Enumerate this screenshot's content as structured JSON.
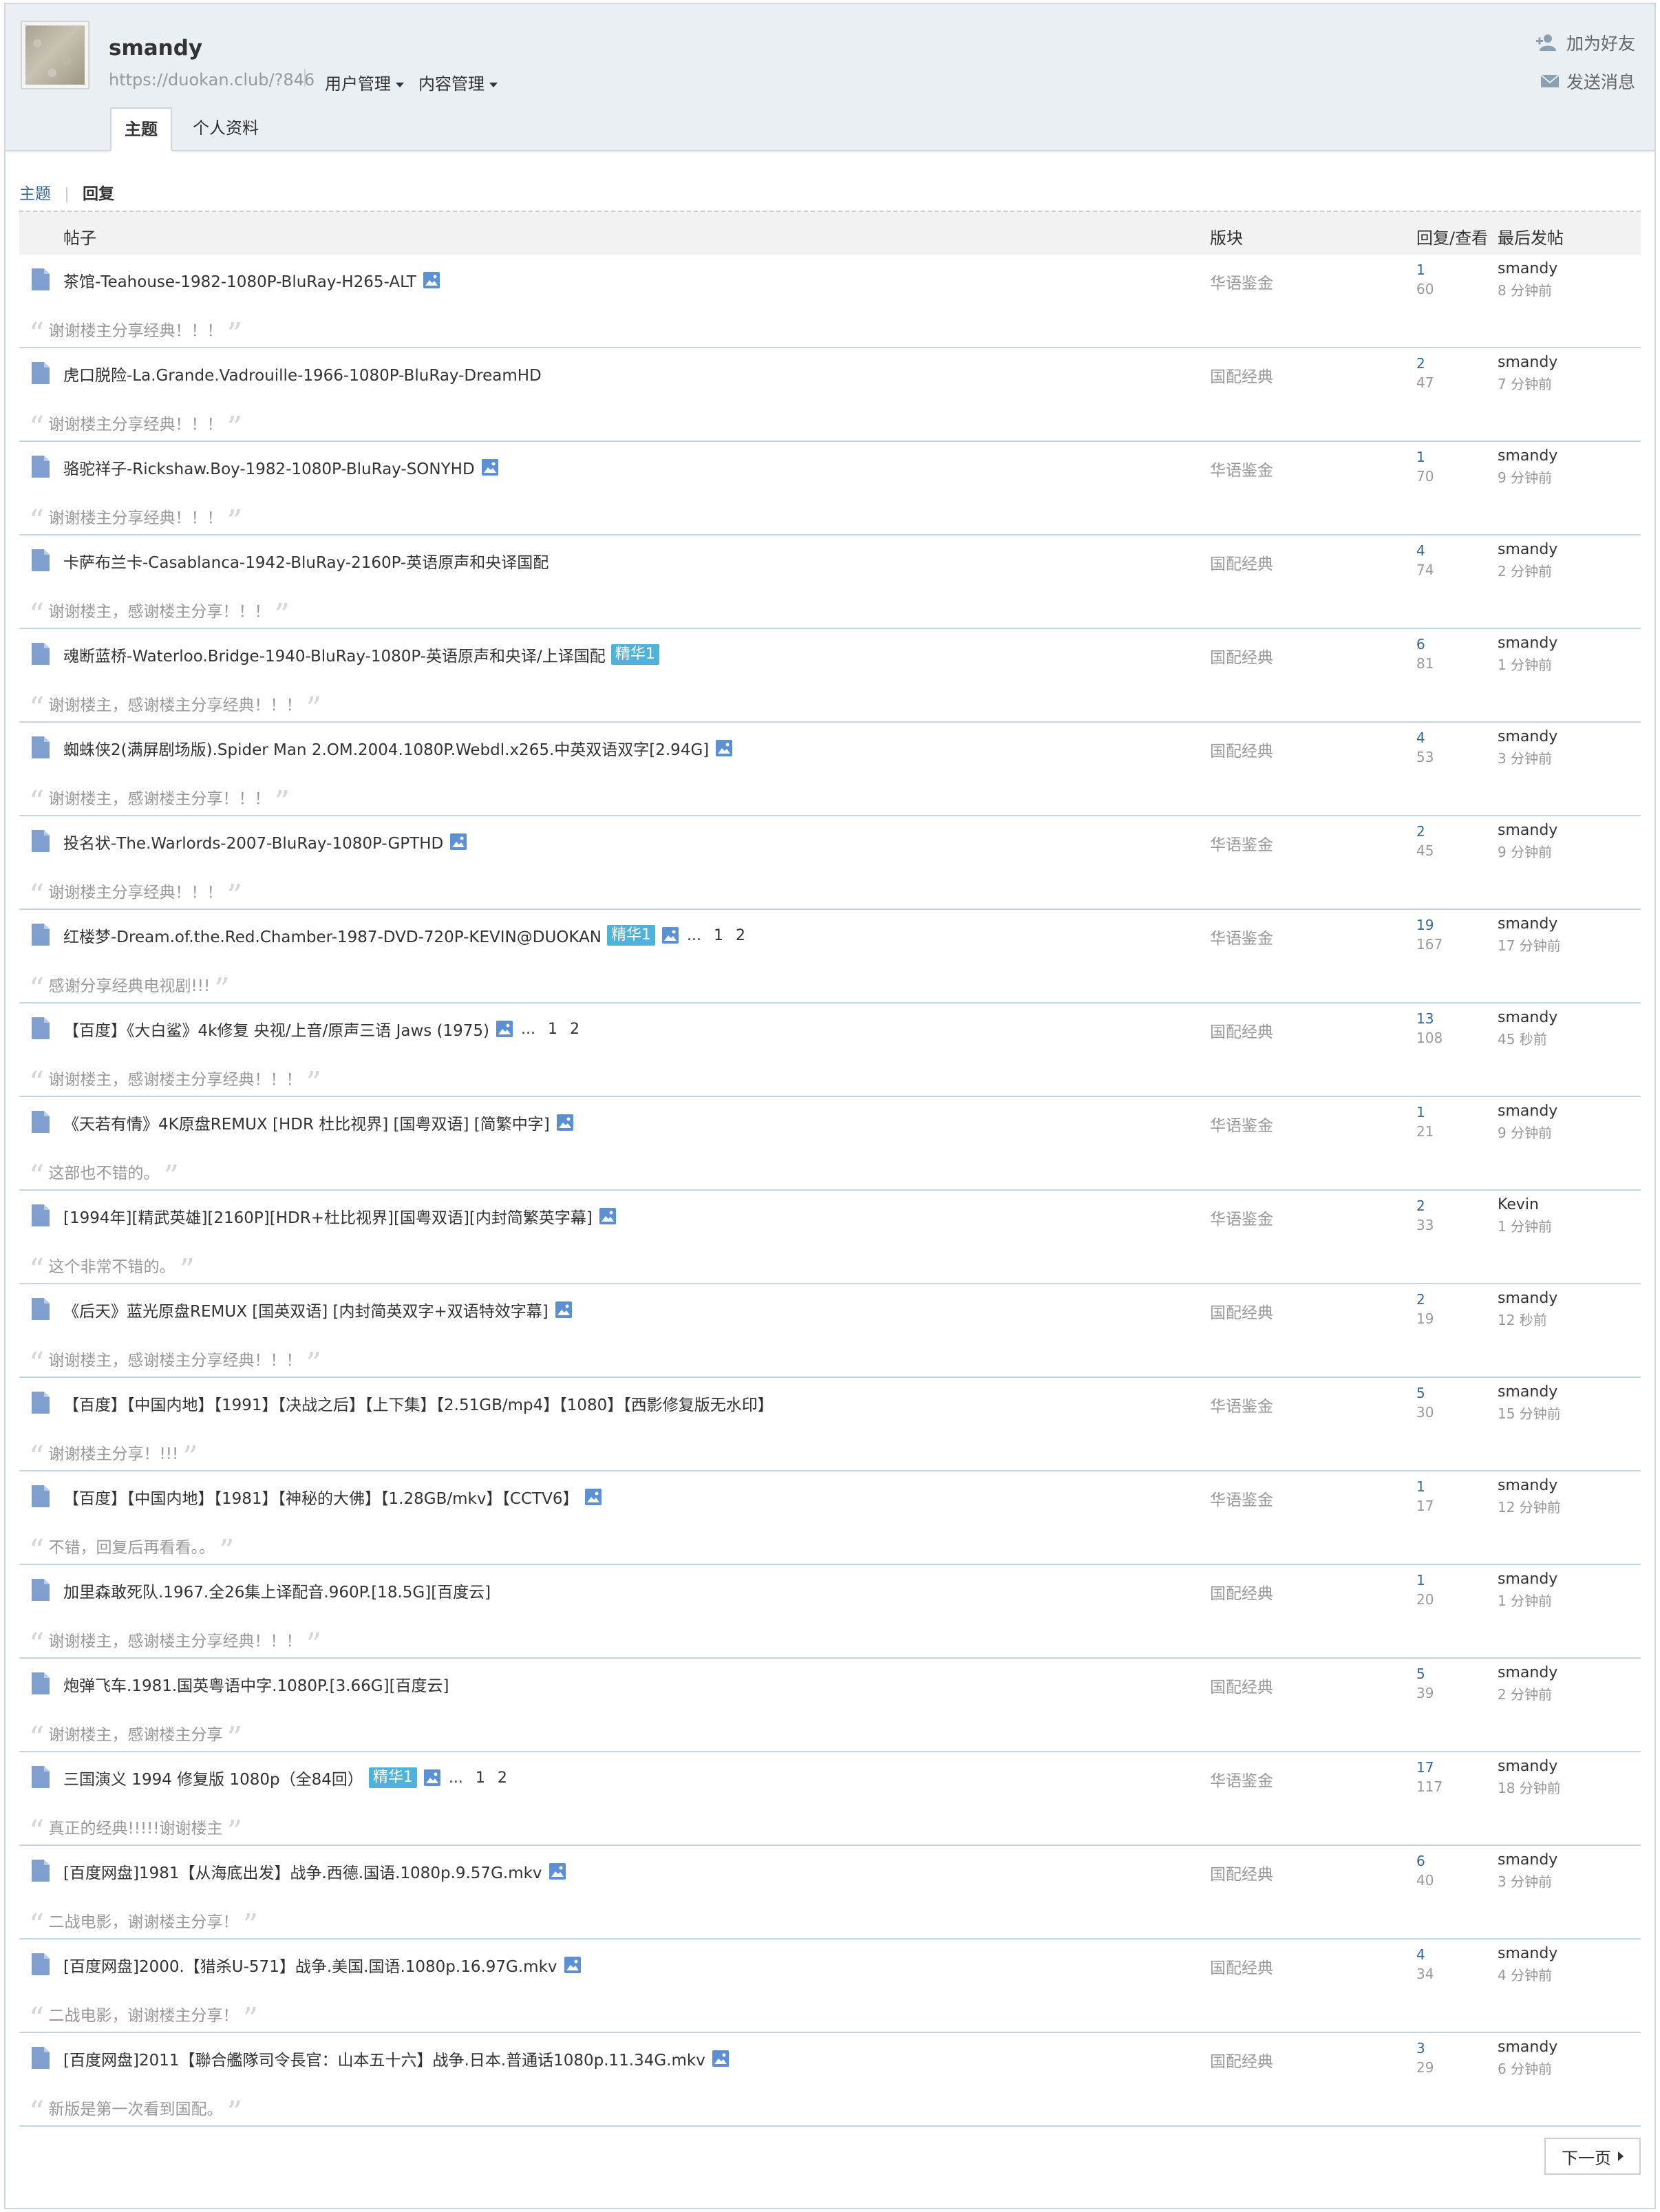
{
  "header": {
    "username": "smandy",
    "profile_url": "https://duokan.club/?846",
    "menus": [
      "用户管理",
      "内容管理"
    ],
    "actions": {
      "add_friend": "加为好友",
      "send_message": "发送消息"
    },
    "tabs": [
      "主题",
      "个人资料"
    ]
  },
  "subnav": {
    "threads": "主题",
    "replies": "回复"
  },
  "table": {
    "columns": {
      "post": "帖子",
      "forum": "版块",
      "replies_views": "回复/查看",
      "last_post": "最后发帖"
    },
    "rows": [
      {
        "title": "茶馆-Teahouse-1982-1080P-BluRay-H265-ALT",
        "image": true,
        "forum": "华语鉴金",
        "replies": "1",
        "views": "60",
        "last_user": "smandy",
        "last_time": "8 分钟前",
        "quote": "谢谢楼主分享经典！！！"
      },
      {
        "title": "虎口脱险-La.Grande.Vadrouille-1966-1080P-BluRay-DreamHD",
        "image": false,
        "forum": "国配经典",
        "replies": "2",
        "views": "47",
        "last_user": "smandy",
        "last_time": "7 分钟前",
        "quote": "谢谢楼主分享经典！！！"
      },
      {
        "title": "骆驼祥子-Rickshaw.Boy-1982-1080P-BluRay-SONYHD",
        "image": true,
        "forum": "华语鉴金",
        "replies": "1",
        "views": "70",
        "last_user": "smandy",
        "last_time": "9 分钟前",
        "quote": "谢谢楼主分享经典！！！"
      },
      {
        "title": "卡萨布兰卡-Casablanca-1942-BluRay-2160P-英语原声和央译国配",
        "image": false,
        "forum": "国配经典",
        "replies": "4",
        "views": "74",
        "last_user": "smandy",
        "last_time": "2 分钟前",
        "quote": "谢谢楼主，感谢楼主分享！！！"
      },
      {
        "title": "魂断蓝桥-Waterloo.Bridge-1940-BluRay-1080P-英语原声和央译/上译国配",
        "image": false,
        "badge": "精华1",
        "forum": "国配经典",
        "replies": "6",
        "views": "81",
        "last_user": "smandy",
        "last_time": "1 分钟前",
        "quote": "谢谢楼主，感谢楼主分享经典！！！"
      },
      {
        "title": "蜘蛛侠2(满屏剧场版).Spider Man 2.OM.2004.1080P.Webdl.x265.中英双语双字[2.94G]",
        "image": true,
        "forum": "国配经典",
        "replies": "4",
        "views": "53",
        "last_user": "smandy",
        "last_time": "3 分钟前",
        "quote": "谢谢楼主，感谢楼主分享！！！"
      },
      {
        "title": "投名状-The.Warlords-2007-BluRay-1080P-GPTHD",
        "image": true,
        "forum": "华语鉴金",
        "replies": "2",
        "views": "45",
        "last_user": "smandy",
        "last_time": "9 分钟前",
        "quote": "谢谢楼主分享经典！！！"
      },
      {
        "title": "红楼梦-Dream.of.the.Red.Chamber-1987-DVD-720P-KEVIN@DUOKAN",
        "image": true,
        "badge": "精华1",
        "pages": [
          "1",
          "2"
        ],
        "forum": "华语鉴金",
        "replies": "19",
        "views": "167",
        "last_user": "smandy",
        "last_time": "17 分钟前",
        "quote": "感谢分享经典电视剧!!!"
      },
      {
        "title": "【百度】《大白鲨》4k修复 央视/上音/原声三语 Jaws (1975)",
        "image": true,
        "pages": [
          "1",
          "2"
        ],
        "forum": "国配经典",
        "replies": "13",
        "views": "108",
        "last_user": "smandy",
        "last_time": "45 秒前",
        "quote": "谢谢楼主，感谢楼主分享经典！！！"
      },
      {
        "title": "《天若有情》4K原盘REMUX [HDR 杜比视界] [国粤双语] [简繁中字]",
        "image": true,
        "forum": "华语鉴金",
        "replies": "1",
        "views": "21",
        "last_user": "smandy",
        "last_time": "9 分钟前",
        "quote": "这部也不错的。"
      },
      {
        "title": "[1994年][精武英雄][2160P][HDR+杜比视界][国粤双语][内封简繁英字幕]",
        "image": true,
        "forum": "华语鉴金",
        "replies": "2",
        "views": "33",
        "last_user": "Kevin",
        "last_time": "1 分钟前",
        "quote": "这个非常不错的。"
      },
      {
        "title": "《后天》蓝光原盘REMUX [国英双语] [内封简英双字+双语特效字幕]",
        "image": true,
        "forum": "国配经典",
        "replies": "2",
        "views": "19",
        "last_user": "smandy",
        "last_time": "12 秒前",
        "quote": "谢谢楼主，感谢楼主分享经典！！！"
      },
      {
        "title": "【百度】【中国内地】【1991】【决战之后】【上下集】【2.51GB/mp4】【1080】【西影修复版无水印】",
        "image": false,
        "forum": "华语鉴金",
        "replies": "5",
        "views": "30",
        "last_user": "smandy",
        "last_time": "15 分钟前",
        "quote": "谢谢楼主分享！!!!"
      },
      {
        "title": "【百度】【中国内地】【1981】【神秘的大佛】【1.28GB/mkv】【CCTV6】",
        "image": true,
        "forum": "华语鉴金",
        "replies": "1",
        "views": "17",
        "last_user": "smandy",
        "last_time": "12 分钟前",
        "quote": "不错，回复后再看看。。"
      },
      {
        "title": "加里森敢死队.1967.全26集上译配音.960P.[18.5G][百度云]",
        "image": false,
        "forum": "国配经典",
        "replies": "1",
        "views": "20",
        "last_user": "smandy",
        "last_time": "1 分钟前",
        "quote": "谢谢楼主，感谢楼主分享经典！！！"
      },
      {
        "title": "炮弹飞车.1981.国英粤语中字.1080P.[3.66G][百度云]",
        "image": false,
        "forum": "国配经典",
        "replies": "5",
        "views": "39",
        "last_user": "smandy",
        "last_time": "2 分钟前",
        "quote": "谢谢楼主，感谢楼主分享"
      },
      {
        "title": "三国演义 1994 修复版 1080p（全84回）",
        "image": true,
        "badge": "精华1",
        "pages": [
          "1",
          "2"
        ],
        "forum": "华语鉴金",
        "replies": "17",
        "views": "117",
        "last_user": "smandy",
        "last_time": "18 分钟前",
        "quote": "真正的经典!!!!!谢谢楼主"
      },
      {
        "title": "[百度网盘]1981【从海底出发】战争.西德.国语.1080p.9.57G.mkv",
        "image": true,
        "forum": "国配经典",
        "replies": "6",
        "views": "40",
        "last_user": "smandy",
        "last_time": "3 分钟前",
        "quote": "二战电影，谢谢楼主分享！"
      },
      {
        "title": "[百度网盘]2000.【猎杀U-571】战争.美国.国语.1080p.16.97G.mkv",
        "image": true,
        "forum": "国配经典",
        "replies": "4",
        "views": "34",
        "last_user": "smandy",
        "last_time": "4 分钟前",
        "quote": "二战电影，谢谢楼主分享！"
      },
      {
        "title": "[百度网盘]2011【聯合艦隊司令長官：山本五十六】战争.日本.普通话1080p.11.34G.mkv",
        "image": true,
        "forum": "国配经典",
        "replies": "3",
        "views": "29",
        "last_user": "smandy",
        "last_time": "6 分钟前",
        "quote": "新版是第一次看到国配。"
      }
    ]
  },
  "pagination": {
    "next_label": "下一页"
  },
  "colors": {
    "link_blue": "#336699",
    "badge": "#4fb3d9",
    "icon_blue": "#5b8fd6",
    "header_bg": "#e9eff3"
  },
  "icons": {
    "doc": "document-icon",
    "image": "image-icon",
    "add_friend": "add-user-icon",
    "message": "envelope-icon"
  }
}
